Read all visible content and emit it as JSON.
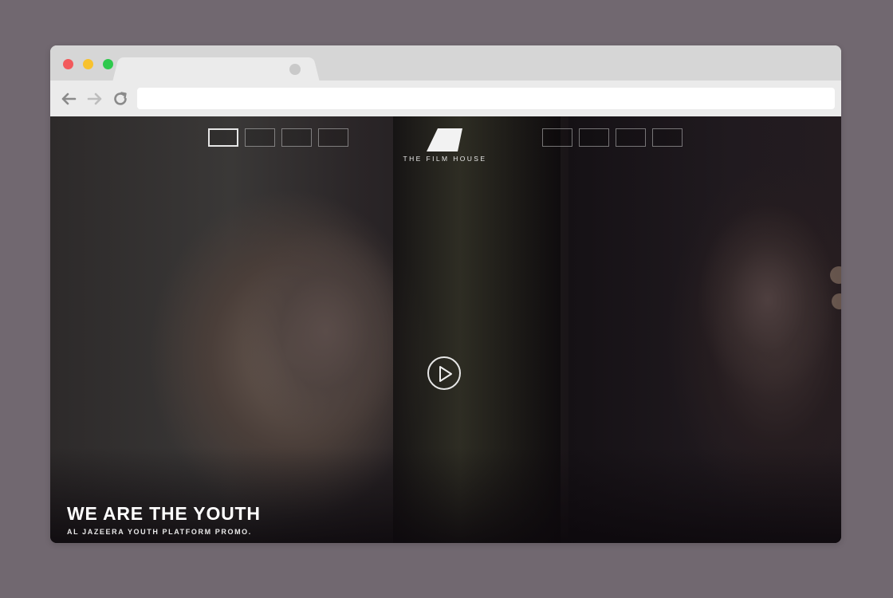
{
  "browser": {
    "url": "",
    "colors": {
      "close": "#f2595c",
      "minimize": "#f8c22e",
      "zoom": "#2fc94d"
    }
  },
  "site": {
    "logo_text": "THE FILM HOUSE",
    "slide_nav_left": [
      {
        "id": "slide-1",
        "active": true
      },
      {
        "id": "slide-2",
        "active": false
      },
      {
        "id": "slide-3",
        "active": false
      },
      {
        "id": "slide-4",
        "active": false
      }
    ],
    "slide_nav_right": [
      {
        "id": "slide-5",
        "active": false
      },
      {
        "id": "slide-6",
        "active": false
      },
      {
        "id": "slide-7",
        "active": false
      },
      {
        "id": "slide-8",
        "active": false
      }
    ],
    "play_icon": "play-icon",
    "caption": {
      "title": "WE ARE THE YOUTH",
      "subtitle": "AL JAZEERA YOUTH PLATFORM PROMO."
    }
  }
}
